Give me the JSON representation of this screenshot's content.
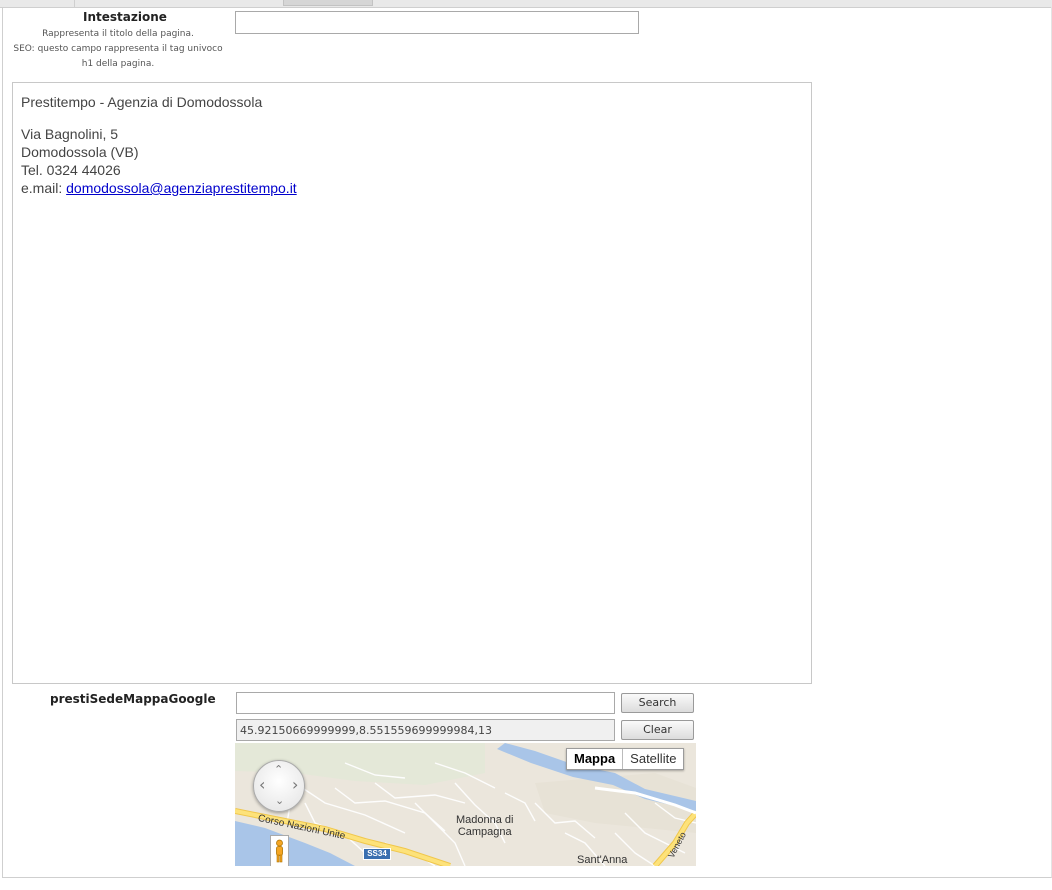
{
  "intestazione": {
    "label": "Intestazione",
    "description": [
      "Rappresenta il titolo della pagina.",
      "SEO: questo campo rappresenta il tag univoco",
      "h1 della pagina."
    ],
    "value": ""
  },
  "editor": {
    "title_line": "Prestitempo - Agenzia di Domodossola",
    "address": "Via Bagnolini, 5",
    "city": "Domodossola (VB)",
    "phone": "Tel. 0324 44026",
    "email_prefix": "e.mail: ",
    "email": "domodossola@agenziaprestitempo.it"
  },
  "map_field": {
    "label": "prestiSedeMappaGoogle",
    "search_value": "",
    "search_button": "Search",
    "coordinates": "45.92150669999999,8.551559699999984,13",
    "clear_button": "Clear",
    "map_type_active": "Mappa",
    "map_type_inactive": "Satellite",
    "places": {
      "road": "Corso Nazioni Unite",
      "place1_line1": "Madonna di",
      "place1_line2": "Campagna",
      "place2": "Sant'Anna",
      "route_shield": "SS34",
      "street_edge": "Veneto"
    },
    "pan_arrows": {
      "up": "⌃",
      "down": "⌄",
      "left": "‹",
      "right": "›"
    }
  },
  "icons": {
    "pan": "pan-control-icon",
    "pegman": "street-view-pegman-icon"
  },
  "colors": {
    "link": "#0000cc",
    "water": "#a9c5e8",
    "road_major": "#fde27a",
    "land": "#ebe6dc"
  }
}
